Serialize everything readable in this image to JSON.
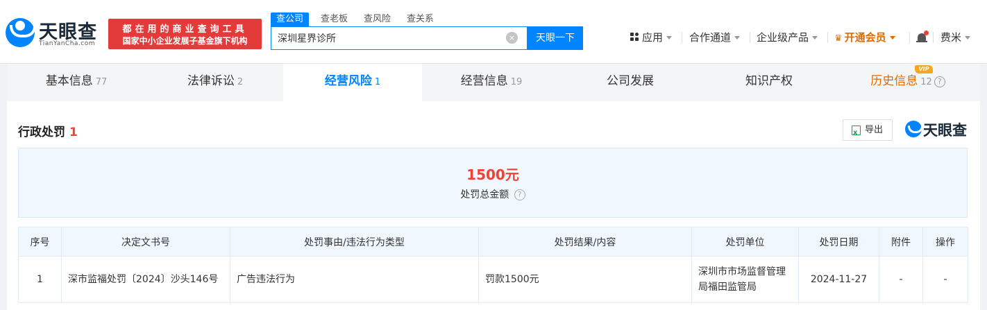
{
  "header": {
    "logo_cn": "天眼查",
    "logo_en": "TianYanCha.com",
    "slogan_line1": "都在用的商业查询工具",
    "slogan_line2": "国家中小企业发展子基金旗下机构",
    "search_tabs": [
      "查公司",
      "查老板",
      "查风险",
      "查关系"
    ],
    "search_value": "深圳星界诊所",
    "clear_glyph": "×",
    "search_button": "天眼一下",
    "nav": {
      "apps": "应用",
      "partner": "合作通道",
      "enterprise": "企业级产品",
      "vip": "开通会员",
      "user": "费米"
    }
  },
  "module_tabs": [
    {
      "label": "基本信息",
      "count": "77"
    },
    {
      "label": "法律诉讼",
      "count": "2"
    },
    {
      "label": "经营风险",
      "count": "1"
    },
    {
      "label": "经营信息",
      "count": "19"
    },
    {
      "label": "公司发展",
      "count": ""
    },
    {
      "label": "知识产权",
      "count": ""
    },
    {
      "label": "历史信息",
      "count": "12"
    }
  ],
  "vip_badge": "VIP",
  "help_glyph": "?",
  "section": {
    "title": "行政处罚",
    "count": "1",
    "export_label": "导出",
    "brand": "天眼查"
  },
  "summary": {
    "amount": "1500元",
    "label": "处罚总金额"
  },
  "table": {
    "headers": [
      "序号",
      "决定文书号",
      "处罚事由/违法行为类型",
      "处罚结果/内容",
      "处罚单位",
      "处罚日期",
      "附件",
      "操作"
    ],
    "rows": [
      {
        "index": "1",
        "doc_no": "深市监福处罚〔2024〕沙头146号",
        "reason": "广告违法行为",
        "result": "罚款1500元",
        "authority": "深圳市市场监督管理局福田监管局",
        "date": "2024-11-27",
        "attachment": "-",
        "action": "-"
      }
    ]
  },
  "colors": {
    "primary": "#0084ff",
    "danger": "#f04134",
    "vip": "#e06a00"
  }
}
